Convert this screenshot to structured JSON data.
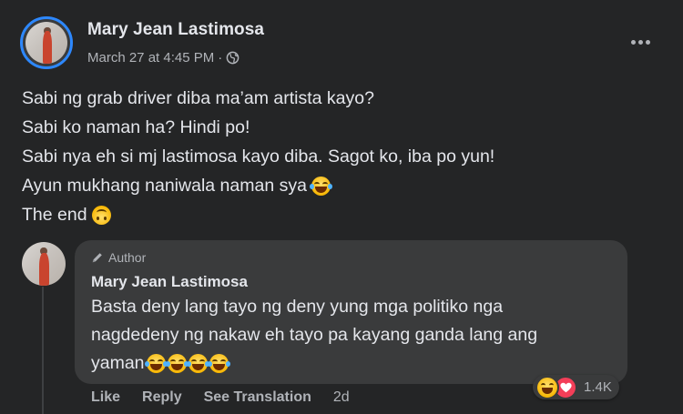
{
  "post": {
    "author": "Mary Jean Lastimosa",
    "timestamp": "March 27 at 4:45 PM",
    "separator": "·",
    "audience_icon": "globe-icon",
    "more_icon": "more-dots-icon",
    "lines": [
      "Sabi ng grab driver diba ma’am artista kayo?",
      "Sabi ko naman ha? Hindi po!",
      "Sabi nya eh si mj lastimosa kayo diba. Sagot ko, iba po yun!",
      "Ayun mukhang naniwala naman sya",
      "The end"
    ],
    "line_emojis": [
      "",
      "",
      "",
      "laughing-tears-emoji",
      "upside-down-face-emoji"
    ]
  },
  "comment": {
    "badge_icon": "pen-icon",
    "badge": "Author",
    "author": "Mary Jean Lastimosa",
    "lines": [
      "Basta deny lang tayo ng deny yung mga politiko nga",
      "nagdedeny ng nakaw eh tayo pa kayang ganda lang ang",
      "yaman"
    ],
    "trailing_emoji_count": 4,
    "trailing_emoji": "laughing-tears-emoji",
    "reactions": {
      "types": [
        "haha",
        "love"
      ],
      "count": "1.4K"
    },
    "actions": {
      "like": "Like",
      "reply": "Reply",
      "see_translation": "See Translation",
      "time": "2d"
    }
  },
  "colors": {
    "background": "#242526",
    "bubble": "#3a3b3c",
    "primary_text": "#e4e6eb",
    "secondary_text": "#b0b3b8",
    "story_ring": "#2d88ff",
    "love": "#f33e58"
  }
}
